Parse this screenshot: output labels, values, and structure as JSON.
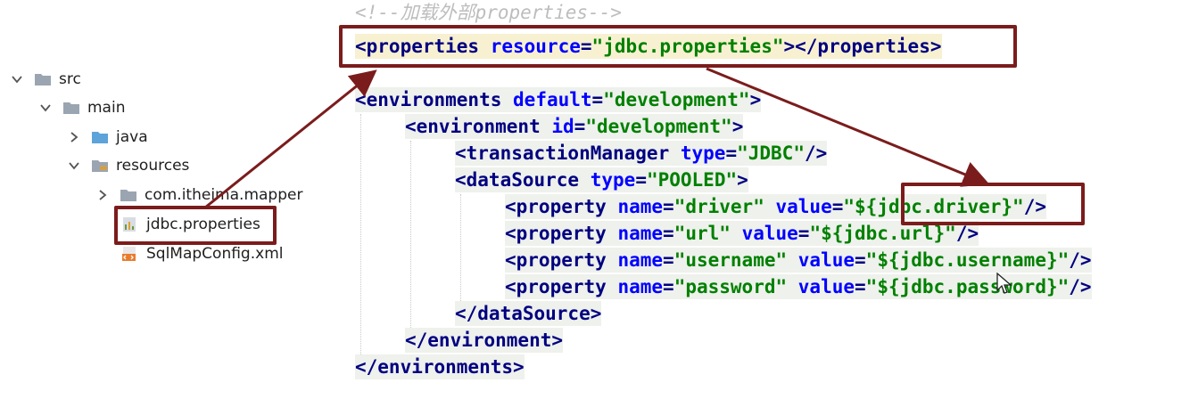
{
  "tree": {
    "items": [
      {
        "label": "src",
        "icon": "folder-icon"
      },
      {
        "label": "main",
        "icon": "folder-icon"
      },
      {
        "label": "java",
        "icon": "source-folder-icon"
      },
      {
        "label": "resources",
        "icon": "resources-folder-icon"
      },
      {
        "label": "com.itheima.mapper",
        "icon": "package-icon"
      },
      {
        "label": "jdbc.properties",
        "icon": "properties-file-icon"
      },
      {
        "label": "SqlMapConfig.xml",
        "icon": "xml-file-icon"
      }
    ]
  },
  "code": {
    "comment": "<!--加载外部properties-->",
    "properties_line": {
      "open": "<properties",
      "attr": "resource",
      "eq": "=",
      "value": "\"jdbc.properties\"",
      "close": "></properties>"
    },
    "environments_open": {
      "tag": "<environments",
      "attr": "default",
      "eq": "=",
      "value": "\"development\"",
      "close": ">"
    },
    "environment_open": {
      "tag": "<environment",
      "attr": "id",
      "eq": "=",
      "value": "\"development\"",
      "close": ">"
    },
    "transaction_manager": {
      "tag": "<transactionManager",
      "attr": "type",
      "eq": "=",
      "value": "\"JDBC\"",
      "close": "/>"
    },
    "datasource_open": {
      "tag": "<dataSource",
      "attr": "type",
      "eq": "=",
      "value": "\"POOLED\"",
      "close": ">"
    },
    "properties": [
      {
        "tag": "<property",
        "name_attr": "name",
        "name_val": "\"driver\"",
        "value_attr": "value",
        "value_open": "\"",
        "value_expr": "${jdbc.driver}",
        "value_close": "\"",
        "close": "/>"
      },
      {
        "tag": "<property",
        "name_attr": "name",
        "name_val": "\"url\"",
        "value_attr": "value",
        "value_open": "\"",
        "value_expr": "${jdbc.url}",
        "value_close": "\"",
        "close": "/>"
      },
      {
        "tag": "<property",
        "name_attr": "name",
        "name_val": "\"username\"",
        "value_attr": "value",
        "value_open": "\"",
        "value_expr": "${jdbc.username}",
        "value_close": "\"",
        "close": "/>"
      },
      {
        "tag": "<property",
        "name_attr": "name",
        "name_val": "\"password\"",
        "value_attr": "value",
        "value_open": "\"",
        "value_expr": "${jdbc.password}",
        "value_close": "\"",
        "close": "/>"
      }
    ],
    "datasource_close": "</dataSource>",
    "environment_close": "</environment>",
    "environments_close": "</environments>"
  },
  "colors": {
    "annotation": "#7b1c1c",
    "tag": "#000080",
    "attribute": "#0000ff",
    "value": "#008000"
  }
}
